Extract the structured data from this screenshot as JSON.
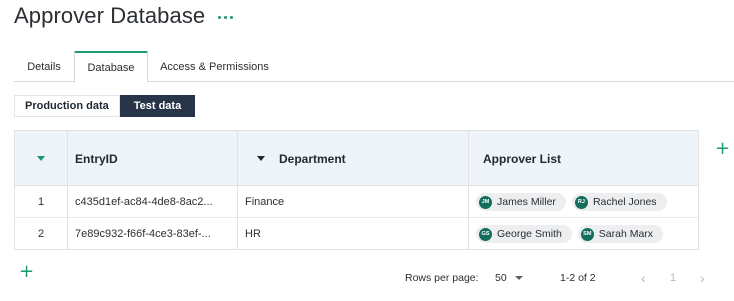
{
  "header": {
    "title": "Approver Database"
  },
  "tabs": [
    {
      "label": "Details"
    },
    {
      "label": "Database"
    },
    {
      "label": "Access & Permissions"
    }
  ],
  "active_tab": "Database",
  "toggle": {
    "production_label": "Production data",
    "test_label": "Test data",
    "selected": "Test data"
  },
  "table": {
    "columns": {
      "entry": "EntryID",
      "department": "Department",
      "approvers": "Approver List"
    },
    "rows": [
      {
        "num": "1",
        "entry_id": "c435d1ef-ac84-4de8-8ac2...",
        "department": "Finance",
        "approvers": [
          {
            "initials": "JM",
            "name": "James Miller"
          },
          {
            "initials": "RJ",
            "name": "Rachel Jones"
          }
        ]
      },
      {
        "num": "2",
        "entry_id": "7e89c932-f66f-4ce3-83ef-...",
        "department": "HR",
        "approvers": [
          {
            "initials": "GS",
            "name": "George Smith"
          },
          {
            "initials": "SM",
            "name": "Sarah Marx"
          }
        ]
      }
    ]
  },
  "footer": {
    "rows_per_page_label": "Rows per page:",
    "rows_per_page_value": "50",
    "range": "1-2 of 2",
    "prev_icon": "‹",
    "page": "1",
    "next_icon": "›"
  },
  "icons": {
    "more": "more-horizontal-icon",
    "add": "plus-icon",
    "expand": "caret-down-icon"
  },
  "colors": {
    "accent": "#1a9a6e",
    "toggle_active_bg": "#283548",
    "header_bg": "#eef4f9",
    "avatar_bg": "#126e5a"
  }
}
